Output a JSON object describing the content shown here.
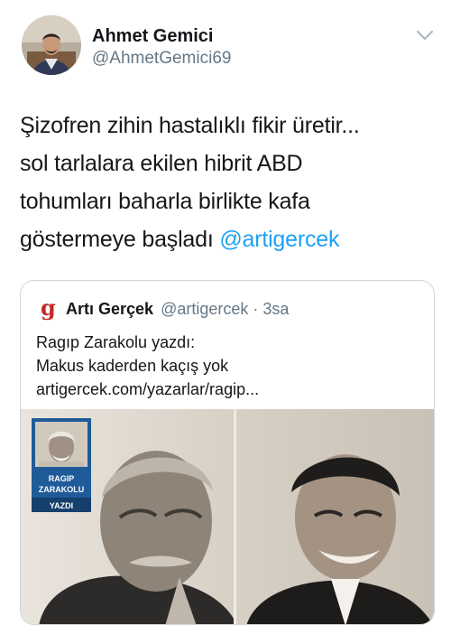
{
  "author": {
    "name": "Ahmet Gemici",
    "handle": "@AhmetGemici69"
  },
  "tweet": {
    "text_lines": [
      "Şizofren zihin hastalıklı fikir üretir...",
      "sol tarlalara ekilen hibrit ABD",
      "tohumları baharla birlikte kafa",
      "göstermeye başladı"
    ],
    "mention": "@artigercek"
  },
  "quote": {
    "logo": "g",
    "name": "Artı Gerçek",
    "meta": "@artigercek · 3sa",
    "lines": [
      "Ragıp Zarakolu yazdı:",
      "Makus kaderden kaçış yok",
      "artigercek.com/yazarlar/ragip..."
    ],
    "badge": {
      "first_name": "RAGIP",
      "last_name": "ZARAKOLU",
      "caption": "YAZDI"
    }
  },
  "icons": {
    "menu": "chevron-down-icon",
    "logo": "arti-gercek-logo"
  },
  "colors": {
    "accent": "#1da1f2",
    "secondary_text": "#657786",
    "border": "#ccd6dd",
    "logo_red": "#c62828",
    "badge_blue": "#1f5a99"
  }
}
